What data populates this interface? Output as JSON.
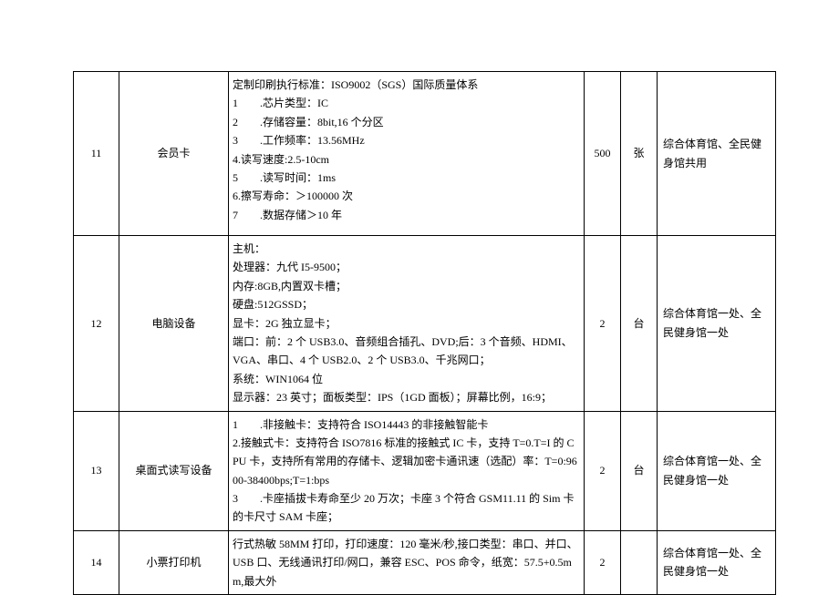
{
  "rows": [
    {
      "idx": "11",
      "name": "会员卡",
      "lines": [
        "定制印刷执行标准：ISO9002（SGS）国际质量体系",
        "1        .芯片类型：IC",
        "2        .存储容量：8bit,16 个分区",
        "3        .工作频率：13.56MHz",
        "4.读写速度:2.5-10cm",
        "5        .读写时间：1ms",
        "6.擦写寿命：＞100000 次",
        "7        .数据存储＞10 年"
      ],
      "qty": "500",
      "unit": "张",
      "remark": "综合体育馆、全民健身馆共用"
    },
    {
      "idx": "12",
      "name": "电脑设备",
      "lines": [
        "主机：",
        "处理器：九代 I5-9500；",
        "内存:8GB,内置双卡槽；",
        "硬盘:512GSSD；",
        "显卡：2G 独立显卡；",
        "端口：前：2 个 USB3.0、音频组合插孔、DVD;后：3 个音频、HDMI、VGA、串口、4 个 USB2.0、2 个 USB3.0、千兆网口；",
        "系统：WIN1064 位",
        "显示器：23 英寸；面板类型：IPS（1GD 面板）；屏幕比例，16:9；"
      ],
      "qty": "2",
      "unit": "台",
      "remark": "综合体育馆一处、全民健身馆一处"
    },
    {
      "idx": "13",
      "name": "桌面式读写设备",
      "lines": [
        "1        .非接触卡：支持符合 ISO14443 的非接触智能卡",
        "2.接触式卡：支持符合 ISO7816 标准的接触式 IC 卡，支持 T=0.T=I 的 CPU 卡，支持所有常用的存储卡、逻辑加密卡通讯速（选配）率：T=0:9600-38400bps;T=1:bps",
        "3        .卡座插拔卡寿命至少 20 万次；卡座 3 个符合 GSM11.11 的 Sim 卡的卡尺寸 SAM 卡座；"
      ],
      "qty": "2",
      "unit": "台",
      "remark": "综合体育馆一处、全民健身馆一处"
    },
    {
      "idx": "14",
      "name": "小票打印机",
      "lines": [
        "行式热敏 58MM 打印，打印速度：120 毫米/秒,接口类型：串口、并口、USB 口、无线通讯打印/网口，兼容 ESC、POS 命令，纸宽：57.5+0.5mm,最大外"
      ],
      "qty": "2",
      "unit": "",
      "remark": "综合体育馆一处、全民健身馆一处"
    }
  ]
}
